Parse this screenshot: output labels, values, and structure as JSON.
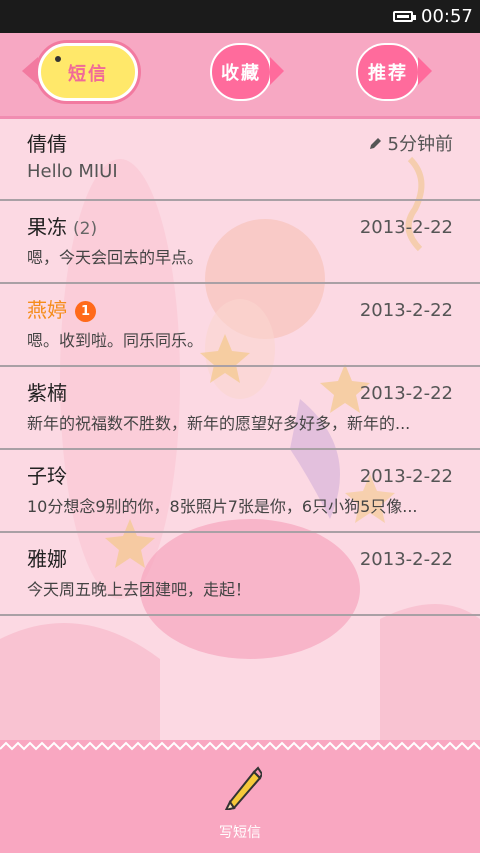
{
  "status_bar": {
    "time": "00:57"
  },
  "tabs": [
    {
      "label": "短信",
      "active": true
    },
    {
      "label": "收藏",
      "active": false
    },
    {
      "label": "推荐",
      "active": false
    }
  ],
  "conversations": [
    {
      "name": "倩倩",
      "count": "",
      "unread_badge": "",
      "date": "5分钟前",
      "draft_icon": "pencil-icon",
      "preview": "Hello MIUI"
    },
    {
      "name": "果冻",
      "count": "(2)",
      "unread_badge": "",
      "date": "2013-2-22",
      "preview": "嗯，今天会回去的早点。"
    },
    {
      "name": "燕婷",
      "count": "",
      "unread_badge": "1",
      "date": "2013-2-22",
      "preview": "嗯。收到啦。同乐同乐。"
    },
    {
      "name": "紫楠",
      "count": "",
      "unread_badge": "",
      "date": "2013-2-22",
      "preview": "新年的祝福数不胜数，新年的愿望好多好多，新年的..."
    },
    {
      "name": "子玲",
      "count": "",
      "unread_badge": "",
      "date": "2013-2-22",
      "preview": "10分想念9别的你，8张照片7张是你，6只小狗5只像..."
    },
    {
      "name": "雅娜",
      "count": "",
      "unread_badge": "",
      "date": "2013-2-22",
      "preview": "今天周五晚上去团建吧，走起！"
    }
  ],
  "compose": {
    "label": "写短信",
    "icon": "pencil-icon"
  },
  "colors": {
    "accent_pink": "#f7a8c3",
    "badge_orange": "#ff6a1a",
    "unread_name": "#f58c1a"
  }
}
